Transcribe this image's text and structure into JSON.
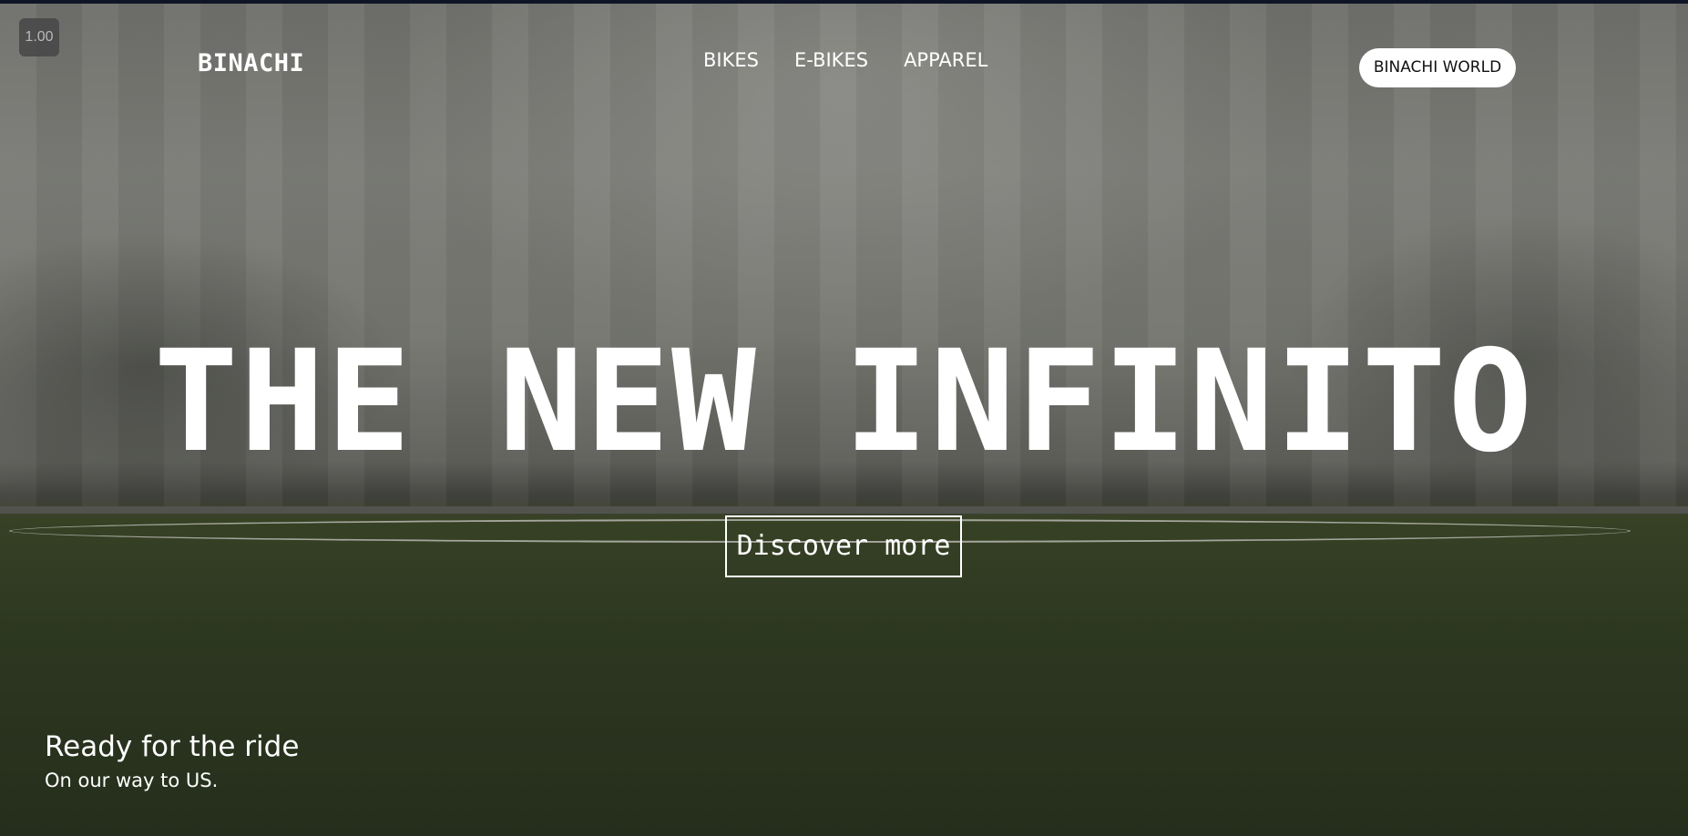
{
  "zoom_badge": "1.00",
  "brand": "BINACHI",
  "nav": {
    "items": [
      {
        "label": "BIKES"
      },
      {
        "label": "E-BIKES"
      },
      {
        "label": "APPAREL"
      }
    ]
  },
  "header_button": "BINACHI WORLD",
  "hero": {
    "headline": "THE NEW INFINITO",
    "cta": "Discover more",
    "tagline": "Ready for the ride",
    "subtagline": "On our way to US."
  }
}
